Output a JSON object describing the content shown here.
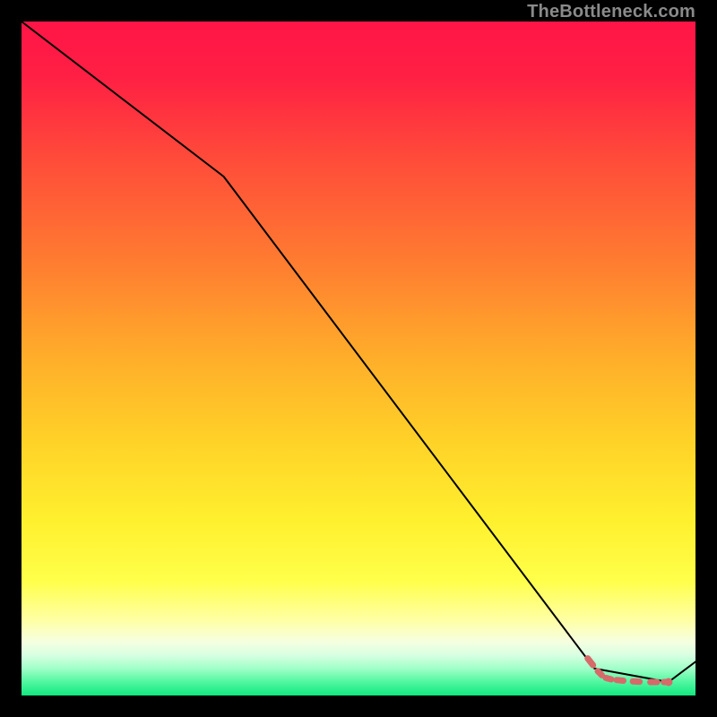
{
  "watermark": "TheBottleneck.com",
  "chart_data": {
    "type": "line",
    "title": "",
    "xlabel": "",
    "ylabel": "",
    "xlim": [
      0,
      100
    ],
    "ylim": [
      0,
      100
    ],
    "grid": false,
    "legend": false,
    "background_gradient_is_data": false,
    "series": [
      {
        "name": "curve",
        "x": [
          0,
          30,
          85,
          96,
          100
        ],
        "y": [
          100,
          77,
          4,
          2,
          5
        ]
      }
    ],
    "markers": {
      "name": "dashed-segment-dots",
      "color": "#d66a6a",
      "points": [
        {
          "x": 84.0,
          "y": 5.5
        },
        {
          "x": 84.8,
          "y": 4.5
        },
        {
          "x": 85.5,
          "y": 3.6
        },
        {
          "x": 86.1,
          "y": 3.0
        },
        {
          "x": 86.7,
          "y": 2.6
        },
        {
          "x": 87.5,
          "y": 2.4
        },
        {
          "x": 88.3,
          "y": 2.3
        },
        {
          "x": 89.3,
          "y": 2.2
        },
        {
          "x": 90.7,
          "y": 2.1
        },
        {
          "x": 91.7,
          "y": 2.05
        },
        {
          "x": 93.3,
          "y": 2.0
        },
        {
          "x": 94.3,
          "y": 2.0
        },
        {
          "x": 95.3,
          "y": 2.0
        },
        {
          "x": 96.0,
          "y": 2.0
        }
      ]
    }
  }
}
